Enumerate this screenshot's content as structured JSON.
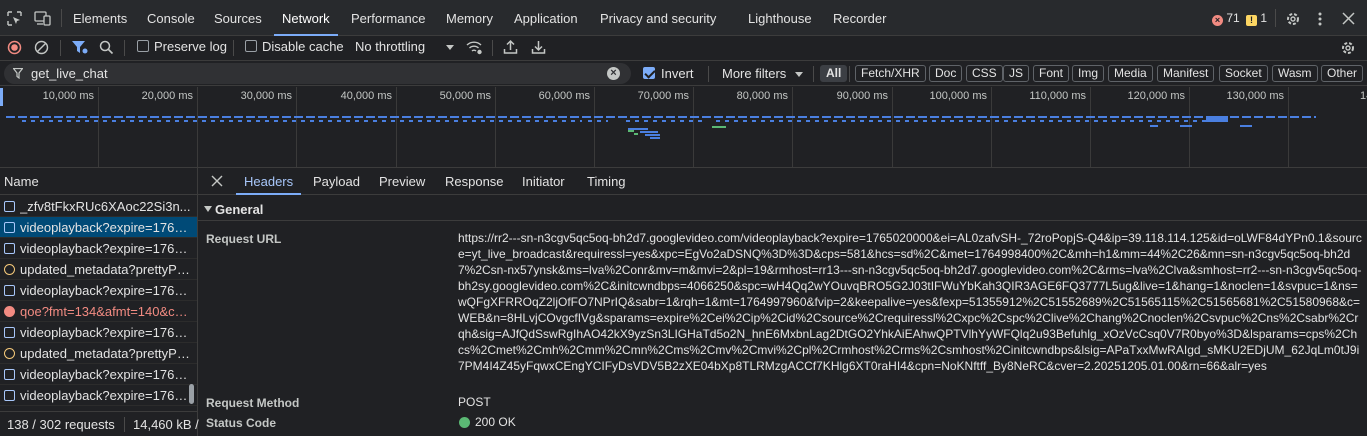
{
  "tabs": [
    {
      "label": "Elements"
    },
    {
      "label": "Console"
    },
    {
      "label": "Sources"
    },
    {
      "label": "Network"
    },
    {
      "label": "Performance"
    },
    {
      "label": "Memory"
    },
    {
      "label": "Application"
    },
    {
      "label": "Privacy and security"
    },
    {
      "label": "Lighthouse"
    },
    {
      "label": "Recorder"
    }
  ],
  "active_tab": "Network",
  "badges": {
    "errors": "71",
    "warnings": "1"
  },
  "toolbar": {
    "preserve_log": "Preserve log",
    "disable_cache": "Disable cache",
    "throttling": "No throttling"
  },
  "filter": {
    "value": "get_live_chat",
    "invert_label": "Invert",
    "more_filters": "More filters",
    "types": [
      "All",
      "Fetch/XHR",
      "Doc",
      "CSS",
      "JS",
      "Font",
      "Img",
      "Media",
      "Manifest",
      "Socket",
      "Wasm",
      "Other"
    ]
  },
  "timeline": {
    "ticks": [
      "10,000 ms",
      "20,000 ms",
      "30,000 ms",
      "40,000 ms",
      "50,000 ms",
      "60,000 ms",
      "70,000 ms",
      "80,000 ms",
      "90,000 ms",
      "100,000 ms",
      "110,000 ms",
      "120,000 ms",
      "130,000 ms",
      "140,"
    ]
  },
  "requests": {
    "column_header": "Name",
    "rows": [
      {
        "name": "_zfv8tFkxRUc6XAoc22Si3n...",
        "type": "other"
      },
      {
        "name": "videoplayback?expire=1765...",
        "type": "media"
      },
      {
        "name": "videoplayback?expire=1765...",
        "type": "media"
      },
      {
        "name": "updated_metadata?prettyPri...",
        "type": "script"
      },
      {
        "name": "videoplayback?expire=1765...",
        "type": "media"
      },
      {
        "name": "qoe?fmt=134&afmt=140&cp...",
        "type": "error"
      },
      {
        "name": "videoplayback?expire=1765...",
        "type": "media"
      },
      {
        "name": "updated_metadata?prettyPri...",
        "type": "script"
      },
      {
        "name": "videoplayback?expire=1765...",
        "type": "media"
      },
      {
        "name": "videoplayback?expire=1765...",
        "type": "media"
      }
    ],
    "summary": "138 / 302 requests",
    "transfer": "14,460 kB /"
  },
  "details": {
    "tabs": [
      "Headers",
      "Payload",
      "Preview",
      "Response",
      "Initiator",
      "Timing"
    ],
    "active": "Headers",
    "section": "General",
    "request_url_label": "Request URL",
    "request_url": "https://rr2---sn-n3cgv5qc5oq-bh2d7.googlevideo.com/videoplayback?expire=1765020000&ei=AL0zafvSH-_72roPopjS-Q4&ip=39.118.114.125&id=oLWF84dYPn0.1&source=yt_live_broadcast&requiressl=yes&xpc=EgVo2aDSNQ%3D%3D&cps=581&hcs=sd%2C&met=1764998400%2C&mh=h1&mm=44%2C26&mn=sn-n3cgv5qc5oq-bh2d7%2Csn-nx57ynsk&ms=lva%2Conr&mv=m&mvi=2&pl=19&rmhost=rr13---sn-n3cgv5qc5oq-bh2d7.googlevideo.com%2C&rms=lva%2Clva&smhost=rr2---sn-n3cgv5qc5oq-bh2sy.googlevideo.com%2C&initcwndbps=4066250&spc=wH4Qq2wYOuvqBRO5G2J03tIFWuYbKah3QIR3AGE6FQ3777L5ug&live=1&hang=1&noclen=1&svpuc=1&ns=wQFgXFRROqZ2ljOfFO7NPrIQ&sabr=1&rqh=1&mt=1764997960&fvip=2&keepalive=yes&fexp=51355912%2C51552689%2C51565115%2C51565681%2C51580968&c=WEB&n=8HLvjCOvgcfIVg&sparams=expire%2Cei%2Cip%2Cid%2Csource%2Crequiressl%2Cxpc%2Cspc%2Clive%2Chang%2Cnoclen%2Csvpuc%2Cns%2Csabr%2Crqh&sig=AJfQdSswRgIhAO42kX9yzSn3LIGHaTd5o2N_hnE6MxbnLag2DtGO2YhkAiEAhwQPTVlhYyWFQlq2u93Befuhlg_xOzVcCsq0V7R0byo%3D&lsparams=cps%2Chcs%2Cmet%2Cmh%2Cmm%2Cmn%2Cms%2Cmv%2Cmvi%2Cpl%2Crmhost%2Crms%2Csmhost%2Cinitcwndbps&lsig=APaTxxMwRAIgd_sMKU2EDjUM_62JqLm0tJ9i7PM4I4Z45yFqwxCEngYCIFyDsVDV5B2zXE04bXp8TLRMzgACCf7KHlg6XT0raHI4&cpn=NoKNftff_By8NeRC&cver=2.20251205.01.00&rn=66&alr=yes",
    "request_method_label": "Request Method",
    "request_method": "POST",
    "status_code_label": "Status Code",
    "status_code": "200 OK"
  },
  "colors": {
    "accent": "#7cacf8",
    "error": "#f28b82",
    "ok": "#5bb974",
    "warning": "#fdd663"
  }
}
